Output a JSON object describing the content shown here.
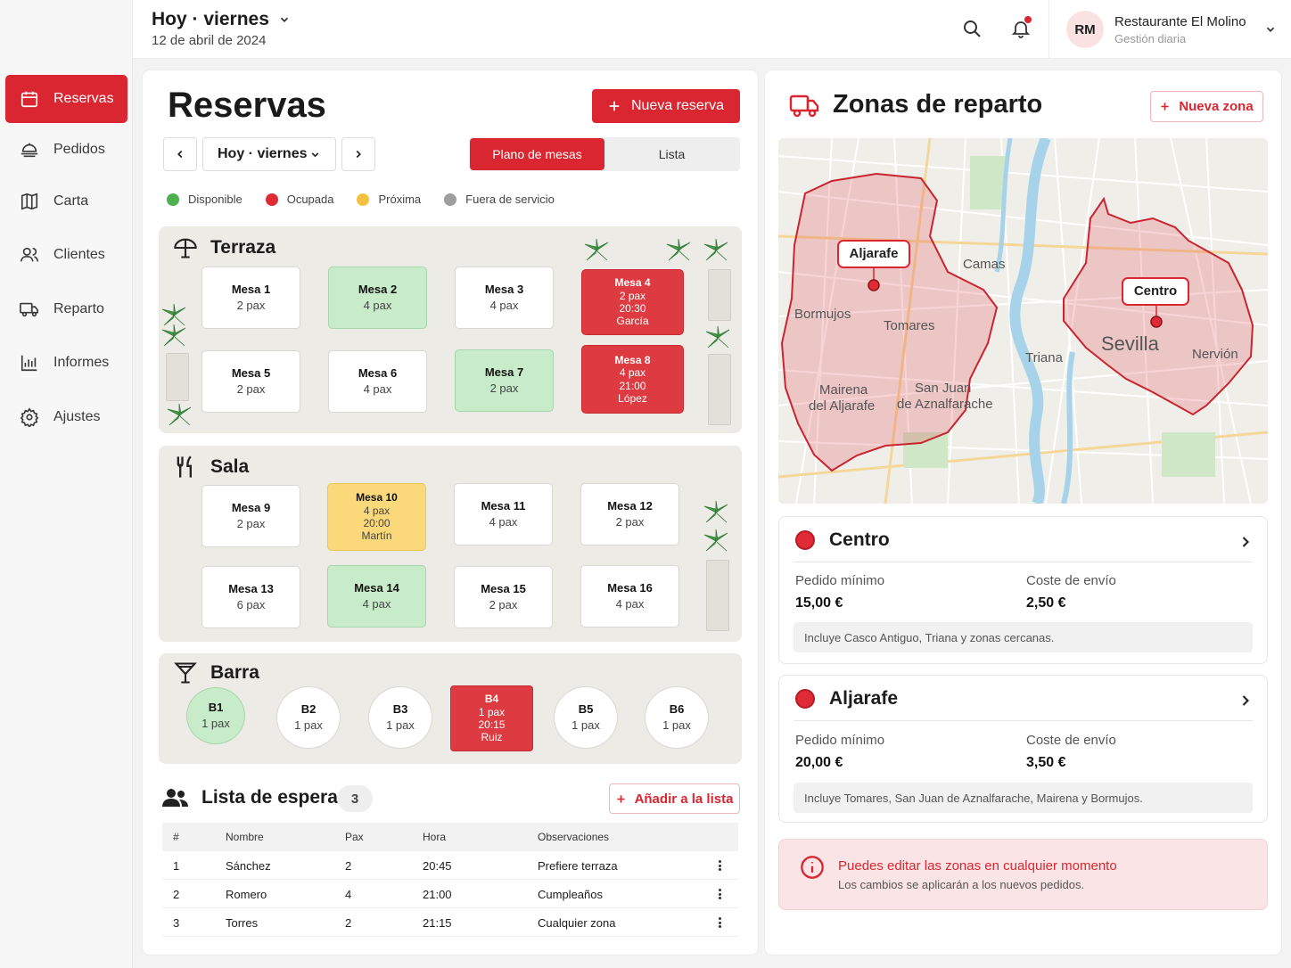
{
  "topbar": {
    "date_title": "Hoy · viernes",
    "date_sub": "12 de abril de 2024",
    "user_initials": "RM",
    "user_name": "Restaurante El Molino",
    "user_role": "Gestión diaria"
  },
  "sidebar": {
    "items": [
      {
        "label": "Reservas",
        "icon": "calendar-icon"
      },
      {
        "label": "Pedidos",
        "icon": "pedidos-icon"
      },
      {
        "label": "Carta",
        "icon": "menu-book-icon"
      },
      {
        "label": "Clientes",
        "icon": "users-icon"
      },
      {
        "label": "Reparto",
        "icon": "truck-icon"
      },
      {
        "label": "Informes",
        "icon": "chart-icon"
      },
      {
        "label": "Ajustes",
        "icon": "gear-icon"
      }
    ]
  },
  "reservas": {
    "title": "Reservas",
    "new_button": "Nueva reserva",
    "day_select": "Hoy · viernes",
    "view_toggle": [
      "Plano de mesas",
      "Lista"
    ],
    "legend": [
      {
        "label": "Disponible",
        "color": "#4caf50"
      },
      {
        "label": "Ocupada",
        "color": "#e02a36"
      },
      {
        "label": "Próxima",
        "color": "#f5c23e"
      },
      {
        "label": "Fuera de servicio",
        "color": "#9e9e9e"
      }
    ],
    "zones": {
      "terraza": {
        "title": "Terraza",
        "tables": [
          {
            "name": "Mesa 1",
            "pax": "2 pax",
            "status": "empty"
          },
          {
            "name": "Mesa 2",
            "pax": "4 pax",
            "status": "free"
          },
          {
            "name": "Mesa 3",
            "pax": "4 pax",
            "status": "empty"
          },
          {
            "name": "Mesa 4",
            "pax": "2 pax",
            "time": "20:30",
            "guest": "García",
            "status": "busy"
          },
          {
            "name": "Mesa 5",
            "pax": "2 pax",
            "status": "empty"
          },
          {
            "name": "Mesa 6",
            "pax": "4 pax",
            "status": "empty"
          },
          {
            "name": "Mesa 7",
            "pax": "2 pax",
            "status": "free"
          },
          {
            "name": "Mesa 8",
            "pax": "4 pax",
            "time": "21:00",
            "guest": "López",
            "status": "busy"
          }
        ]
      },
      "sala": {
        "title": "Sala",
        "tables": [
          {
            "name": "Mesa 9",
            "pax": "2 pax",
            "status": "empty"
          },
          {
            "name": "Mesa 10",
            "pax": "4 pax",
            "time": "20:00",
            "guest": "Martín",
            "status": "next"
          },
          {
            "name": "Mesa 11",
            "pax": "4 pax",
            "status": "empty"
          },
          {
            "name": "Mesa 12",
            "pax": "2 pax",
            "status": "empty"
          },
          {
            "name": "Mesa 13",
            "pax": "6 pax",
            "status": "empty"
          },
          {
            "name": "Mesa 14",
            "pax": "4 pax",
            "status": "free"
          },
          {
            "name": "Mesa 15",
            "pax": "2 pax",
            "status": "empty"
          },
          {
            "name": "Mesa 16",
            "pax": "4 pax",
            "status": "empty"
          }
        ]
      },
      "barra": {
        "title": "Barra",
        "seats": [
          {
            "name": "B1",
            "pax": "1 pax",
            "status": "free"
          },
          {
            "name": "B2",
            "pax": "1 pax",
            "status": "empty"
          },
          {
            "name": "B3",
            "pax": "1 pax",
            "status": "empty"
          },
          {
            "name": "B4",
            "pax": "1 pax",
            "time": "20:15",
            "guest": "Ruiz",
            "status": "busy"
          },
          {
            "name": "B5",
            "pax": "1 pax",
            "status": "empty"
          },
          {
            "name": "B6",
            "pax": "1 pax",
            "status": "empty"
          }
        ]
      }
    }
  },
  "waitlist": {
    "title": "Lista de espera",
    "count": "3",
    "add_button": "Añadir a la lista",
    "columns": [
      "#",
      "Nombre",
      "Pax",
      "Hora",
      "Observaciones"
    ],
    "rows": [
      {
        "n": "1",
        "name": "Sánchez",
        "pax": "2",
        "time": "20:45",
        "notes": "Prefiere terraza"
      },
      {
        "n": "2",
        "name": "Romero",
        "pax": "4",
        "time": "21:00",
        "notes": "Cumpleaños"
      },
      {
        "n": "3",
        "name": "Torres",
        "pax": "2",
        "time": "21:15",
        "notes": "Cualquier zona"
      }
    ]
  },
  "delivery": {
    "title": "Zonas de reparto",
    "new_zone_button": "Nueva zona",
    "map_labels": {
      "pin_aljarafe": "Aljarafe",
      "pin_centro": "Centro",
      "camas": "Camas",
      "bormujos": "Bormujos",
      "tomares": "Tomares",
      "triana": "Triana",
      "sevilla": "Sevilla",
      "nervion": "Nervión",
      "mairena_1": "Mairena",
      "mairena_2": "del Aljarafe",
      "sanjuan_1": "San Juan",
      "sanjuan_2": "de Aznalfarache"
    },
    "zones": [
      {
        "name": "Centro",
        "min_label": "Pedido mínimo",
        "min_value": "15,00 €",
        "cost_label": "Coste de envío",
        "cost_value": "2,50 €",
        "note": "Incluye Casco Antiguo, Triana y zonas cercanas."
      },
      {
        "name": "Aljarafe",
        "min_label": "Pedido mínimo",
        "min_value": "20,00 €",
        "cost_label": "Coste de envío",
        "cost_value": "3,50 €",
        "note": "Incluye Tomares, San Juan de Aznalfarache, Mairena y Bormujos."
      }
    ],
    "info_title": "Puedes editar las zonas en cualquier momento",
    "info_sub": "Los cambios se aplicarán a los nuevos pedidos."
  },
  "colors": {
    "accent": "#d92631",
    "free": "#c8ecc9",
    "next": "#fbd97a",
    "busy": "#de3a42"
  }
}
